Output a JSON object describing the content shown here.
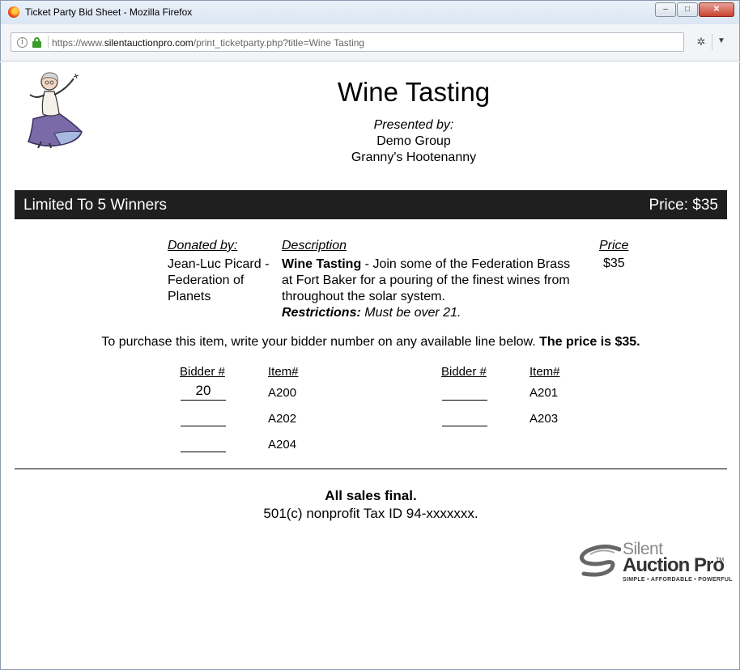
{
  "window": {
    "title": "Ticket Party Bid Sheet - Mozilla Firefox",
    "controls": [
      "–",
      "□",
      "✕"
    ]
  },
  "navbar": {
    "url_prefix": "https://www.",
    "url_host": "silentauctionpro.com",
    "url_path": "/print_ticketparty.php?title=Wine Tasting"
  },
  "header": {
    "title": "Wine Tasting",
    "presented_by": "Presented by:",
    "presenters": [
      "Demo Group",
      "Granny's Hootenanny"
    ]
  },
  "bar": {
    "left": "Limited To 5 Winners",
    "right": "Price: $35"
  },
  "details": {
    "donated_header": "Donated by:",
    "description_header": "Description",
    "price_header": "Price",
    "donor": "Jean-Luc Picard - Federation of Planets",
    "item_name": "Wine Tasting",
    "description": " - Join some of the Federation Brass at Fort Baker for a pouring of the finest wines from throughout the solar system.",
    "restrictions_label": "Restrictions:",
    "restrictions": " Must be over 21.",
    "price": "$35"
  },
  "instructions": {
    "text": "To purchase this item, write your bidder number on any available line below. ",
    "bold": "The price is $35."
  },
  "bid_grid": {
    "bidder_header": "Bidder #",
    "item_header": "Item#",
    "entries": [
      {
        "bidder": "20",
        "item": "A200"
      },
      {
        "bidder": "",
        "item": "A201"
      },
      {
        "bidder": "",
        "item": "A202"
      },
      {
        "bidder": "",
        "item": "A203"
      },
      {
        "bidder": "",
        "item": "A204"
      }
    ]
  },
  "footer": {
    "final": "All sales final.",
    "tax_id": "501(c) nonprofit Tax ID 94-xxxxxxx."
  },
  "logo": {
    "line1": "Silent",
    "line2": "Auction Pro",
    "tm": "TM",
    "tagline": "SIMPLE • AFFORDABLE • POWERFUL"
  }
}
